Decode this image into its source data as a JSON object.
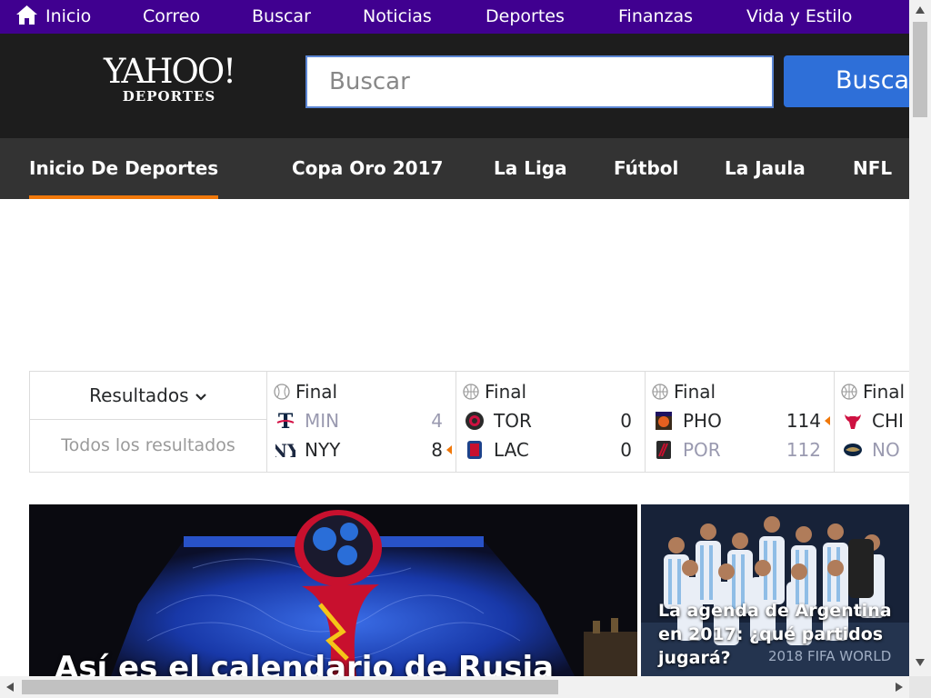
{
  "topnav": {
    "items": [
      {
        "label": "Inicio",
        "icon": "home-icon"
      },
      {
        "label": "Correo"
      },
      {
        "label": "Buscar"
      },
      {
        "label": "Noticias"
      },
      {
        "label": "Deportes"
      },
      {
        "label": "Finanzas"
      },
      {
        "label": "Vida y Estilo"
      }
    ]
  },
  "header": {
    "logo_line1": "YAHOO!",
    "logo_line2": "DEPORTES",
    "search_placeholder": "Buscar",
    "search_button": "Buscar"
  },
  "sportsnav": {
    "tabs": [
      {
        "label": "Inicio De Deportes",
        "active": true
      },
      {
        "label": "Copa Oro 2017"
      },
      {
        "label": "La Liga"
      },
      {
        "label": "Fútbol"
      },
      {
        "label": "La Jaula"
      },
      {
        "label": "NFL"
      }
    ]
  },
  "scores": {
    "header": "Resultados",
    "all_results": "Todos los resultados",
    "games": [
      {
        "status": "Final",
        "sport_icon": "baseball-icon",
        "away": {
          "abbr": "MIN",
          "score": "4",
          "winner": false,
          "logo": "twins-logo"
        },
        "home": {
          "abbr": "NYY",
          "score": "8",
          "winner": true,
          "logo": "yankees-logo"
        }
      },
      {
        "status": "Final",
        "sport_icon": "basketball-icon",
        "away": {
          "abbr": "TOR",
          "score": "0",
          "winner": false,
          "logo": "raptors-logo"
        },
        "home": {
          "abbr": "LAC",
          "score": "0",
          "winner": false,
          "logo": "clippers-logo"
        }
      },
      {
        "status": "Final",
        "sport_icon": "basketball-icon",
        "away": {
          "abbr": "PHO",
          "score": "114",
          "winner": true,
          "logo": "suns-logo"
        },
        "home": {
          "abbr": "POR",
          "score": "112",
          "winner": false,
          "logo": "blazers-logo"
        }
      },
      {
        "status": "Final",
        "sport_icon": "basketball-icon",
        "away": {
          "abbr": "CHI",
          "score": "",
          "winner": false,
          "logo": "bulls-logo"
        },
        "home": {
          "abbr": "NO",
          "score": "",
          "winner": false,
          "logo": "pelicans-logo"
        }
      }
    ]
  },
  "hero": {
    "main_title": "Así es el calendario de Rusia",
    "side_title": "La agenda de Argentina en 2017: ¿qué partidos jugará?",
    "side_banner": "2018 FIFA WORLD"
  },
  "colors": {
    "topbar": "#400090",
    "header": "#1d1d1d",
    "sportsnav": "#333333",
    "active_underline": "#f0780a",
    "search_button": "#2e6fd8"
  }
}
